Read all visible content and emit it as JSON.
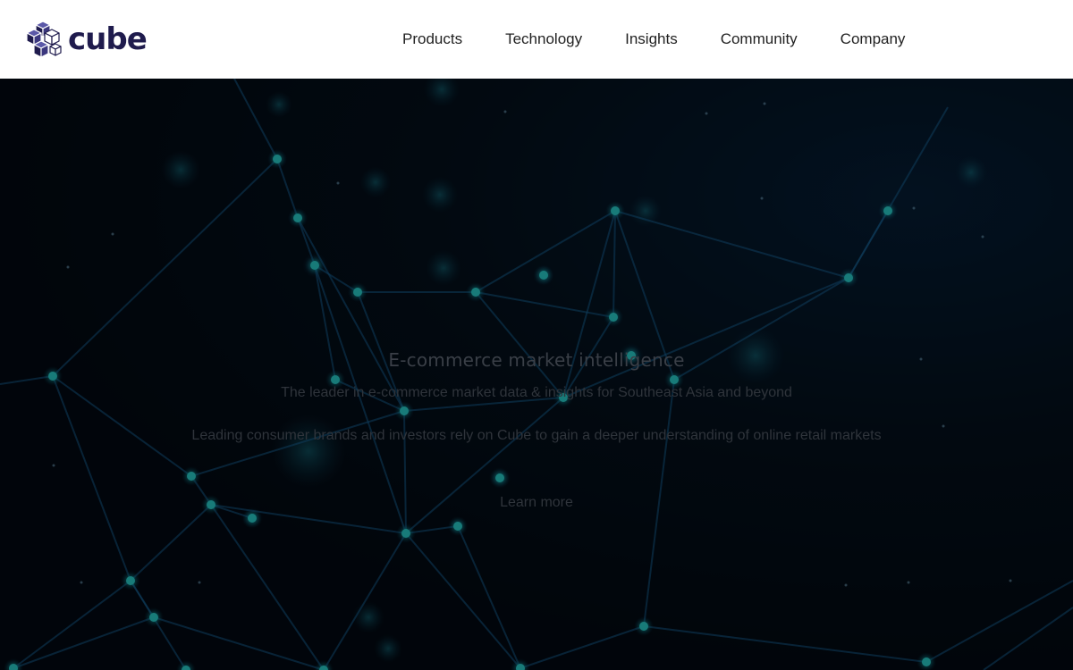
{
  "header": {
    "logo_text": "cube",
    "logo_icon": "cube-stack-icon",
    "nav": [
      {
        "label": "Products"
      },
      {
        "label": "Technology"
      },
      {
        "label": "Insights"
      },
      {
        "label": "Community"
      },
      {
        "label": "Company"
      }
    ]
  },
  "hero": {
    "title": "E-commerce market intelligence",
    "subtitle": "The leader in e-commerce market data & insights for Southeast Asia and beyond",
    "description": "Leading consumer brands and investors rely on Cube to gain a deeper understanding of online retail markets",
    "cta_label": "Learn more",
    "background": "network-graph-image"
  },
  "colors": {
    "brand": "#1f1b4d",
    "node": "#1fd6d6",
    "edge": "#1b6fa8",
    "background": "#020a14"
  }
}
